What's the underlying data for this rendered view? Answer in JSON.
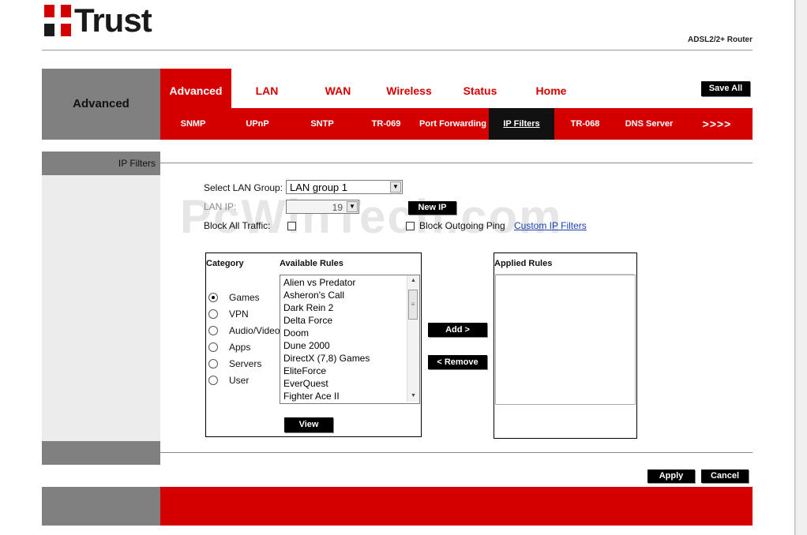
{
  "header": {
    "brand": "Trust",
    "model": "ADSL2/2+ Router"
  },
  "nav": {
    "section_label": "Advanced",
    "main_tabs": [
      {
        "label": "Advanced",
        "active": true
      },
      {
        "label": "LAN",
        "active": false
      },
      {
        "label": "WAN",
        "active": false
      },
      {
        "label": "Wireless",
        "active": false
      },
      {
        "label": "Status",
        "active": false
      },
      {
        "label": "Home",
        "active": false
      }
    ],
    "save_all": "Save All",
    "sub_tabs": [
      {
        "label": "SNMP",
        "active": false
      },
      {
        "label": "UPnP",
        "active": false
      },
      {
        "label": "SNTP",
        "active": false
      },
      {
        "label": "TR-069",
        "active": false
      },
      {
        "label": "Port Forwarding",
        "active": false
      },
      {
        "label": "IP Filters",
        "active": true
      },
      {
        "label": "TR-068",
        "active": false
      },
      {
        "label": "DNS Server",
        "active": false
      },
      {
        "label": ">>>>",
        "active": false
      }
    ]
  },
  "section": {
    "title": "IP Filters"
  },
  "form": {
    "lan_group_label": "Select LAN Group:",
    "lan_group_value": "LAN group 1",
    "lan_ip_label": "LAN IP:",
    "lan_ip_value": "19",
    "new_ip_button": "New IP",
    "block_all_label": "Block All Traffic:",
    "block_outgoing_label": "Block Outgoing Ping",
    "custom_filters_link": "Custom IP Filters"
  },
  "watermark": "PcWinTech.com",
  "category_panel": {
    "category_header": "Category",
    "rules_header": "Available Rules",
    "categories": [
      {
        "label": "Games",
        "selected": true
      },
      {
        "label": "VPN",
        "selected": false
      },
      {
        "label": "Audio/Video",
        "selected": false
      },
      {
        "label": "Apps",
        "selected": false
      },
      {
        "label": "Servers",
        "selected": false
      },
      {
        "label": "User",
        "selected": false
      }
    ],
    "rules": [
      "Alien vs Predator",
      "Asheron's Call",
      "Dark Rein 2",
      "Delta Force",
      "Doom",
      "Dune 2000",
      "DirectX (7,8) Games",
      "EliteForce",
      "EverQuest",
      "Fighter Ace II"
    ],
    "view_button": "View"
  },
  "actions": {
    "add_button": "Add >",
    "remove_button": "< Remove"
  },
  "applied_panel": {
    "header": "Applied Rules"
  },
  "footer": {
    "apply_button": "Apply",
    "cancel_button": "Cancel"
  },
  "colors": {
    "brand_red": "#d40000",
    "nav_gray": "#808080"
  }
}
